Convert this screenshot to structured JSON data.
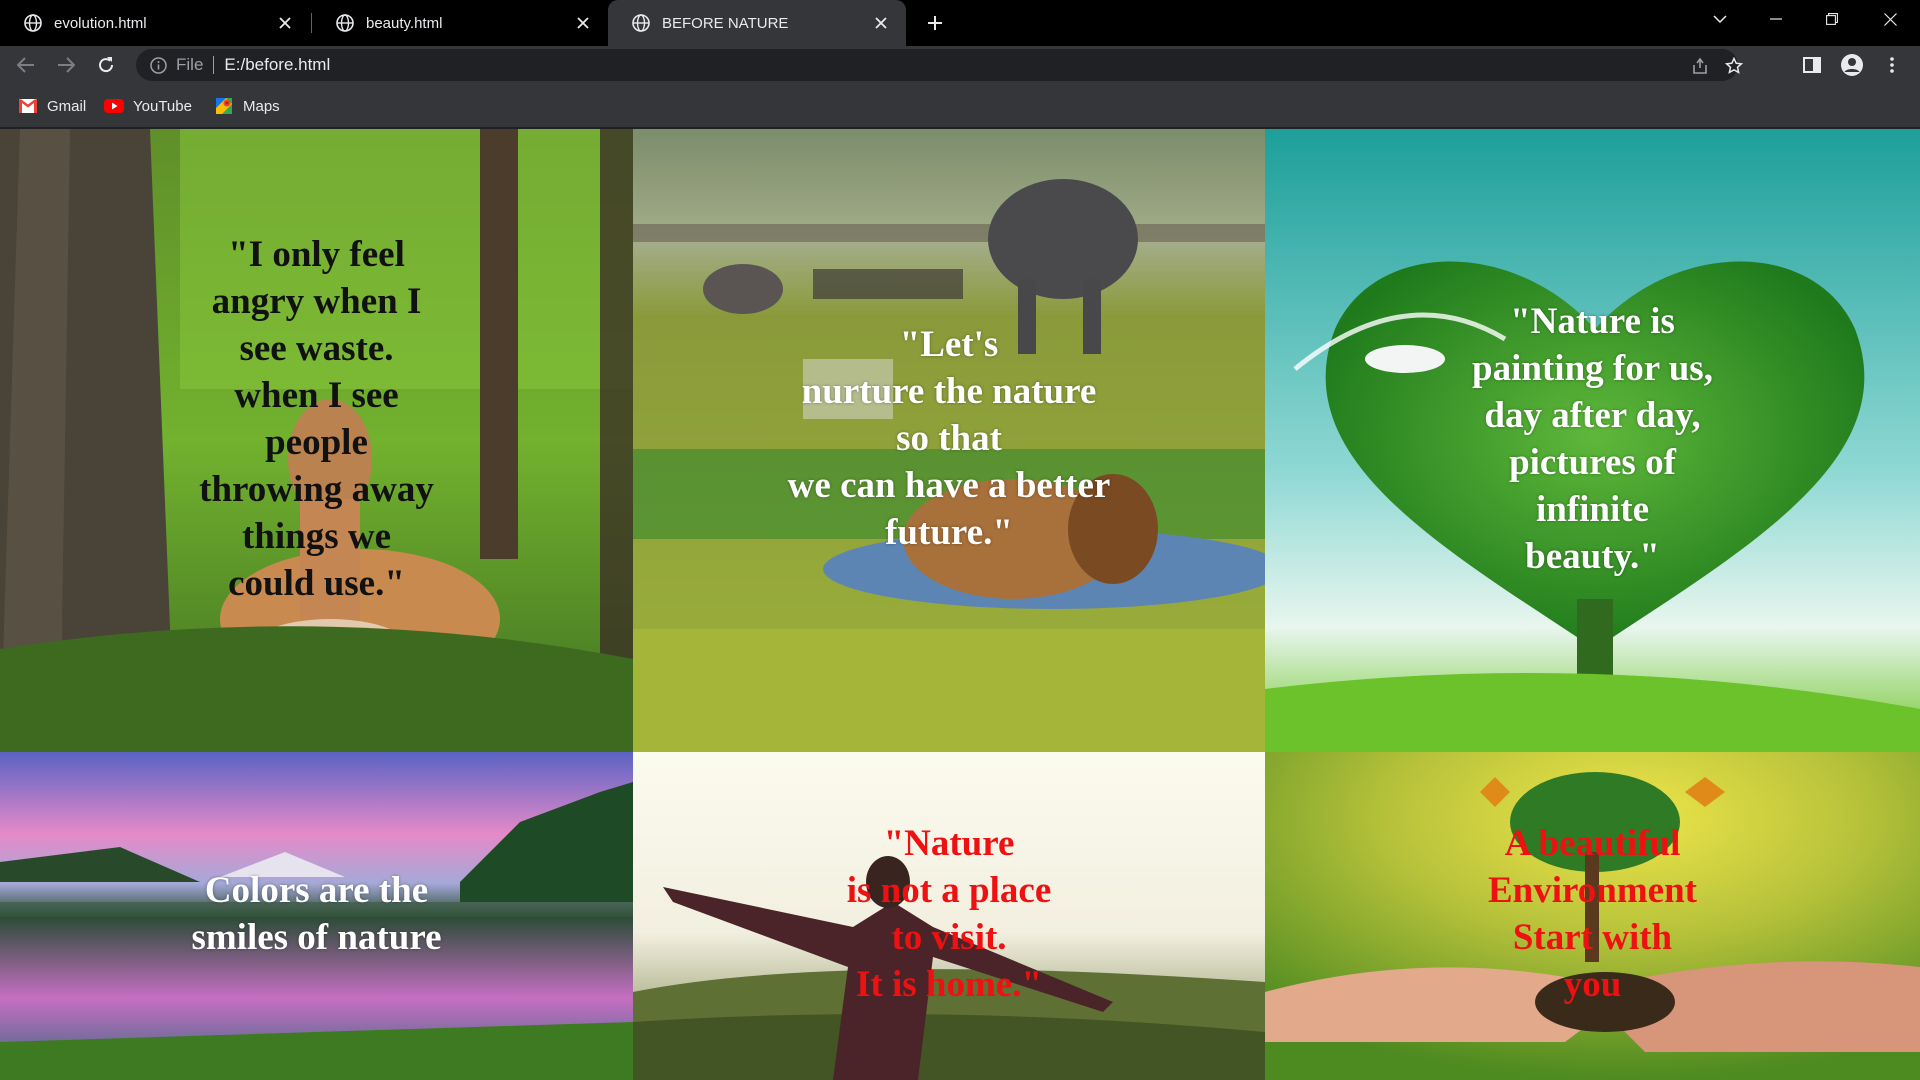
{
  "browser": {
    "tabs": [
      {
        "label": "evolution.html",
        "active": false
      },
      {
        "label": "beauty.html",
        "active": false
      },
      {
        "label": "BEFORE NATURE",
        "active": true
      }
    ],
    "address": {
      "scheme_chip": "File",
      "url": "E:/before.html"
    },
    "bookmarks": [
      {
        "label": "Gmail",
        "icon": "gmail-icon"
      },
      {
        "label": "YouTube",
        "icon": "youtube-icon"
      },
      {
        "label": "Maps",
        "icon": "maps-icon"
      }
    ]
  },
  "page": {
    "tiles": [
      {
        "scene": "deer in forest",
        "quote": "\"I only feel\nangry when I\nsee waste.\nwhen I see\npeople\nthrowing away\nthings we\ncould use.\"",
        "text_color": "black"
      },
      {
        "scene": "savanna with elephant, zebras and lion",
        "quote": "\"Let's\nnurture the nature\nso that\nwe can have a better\nfuture.\"",
        "text_color": "white"
      },
      {
        "scene": "heart-shaped tree with dove",
        "quote": "\"Nature is\npainting for us,\nday after day,\npictures of\ninfinite\nbeauty.\"",
        "text_color": "white"
      },
      {
        "scene": "mountain lake at sunset",
        "quote": "Colors are the\nsmiles of nature",
        "text_color": "white"
      },
      {
        "scene": "woman with open arms on hill",
        "quote": "\"Nature\nis not a place\nto visit.\nIt is home.\"",
        "text_color": "red"
      },
      {
        "scene": "hands holding small tree with butterflies",
        "quote": "A beautiful\nEnvironment\nStart with\nyou",
        "text_color": "red"
      }
    ]
  },
  "colors": {
    "tab_bar": "#000000",
    "toolbar": "#35363a",
    "omnibox": "#202124",
    "quote_red": "#ee1111"
  }
}
